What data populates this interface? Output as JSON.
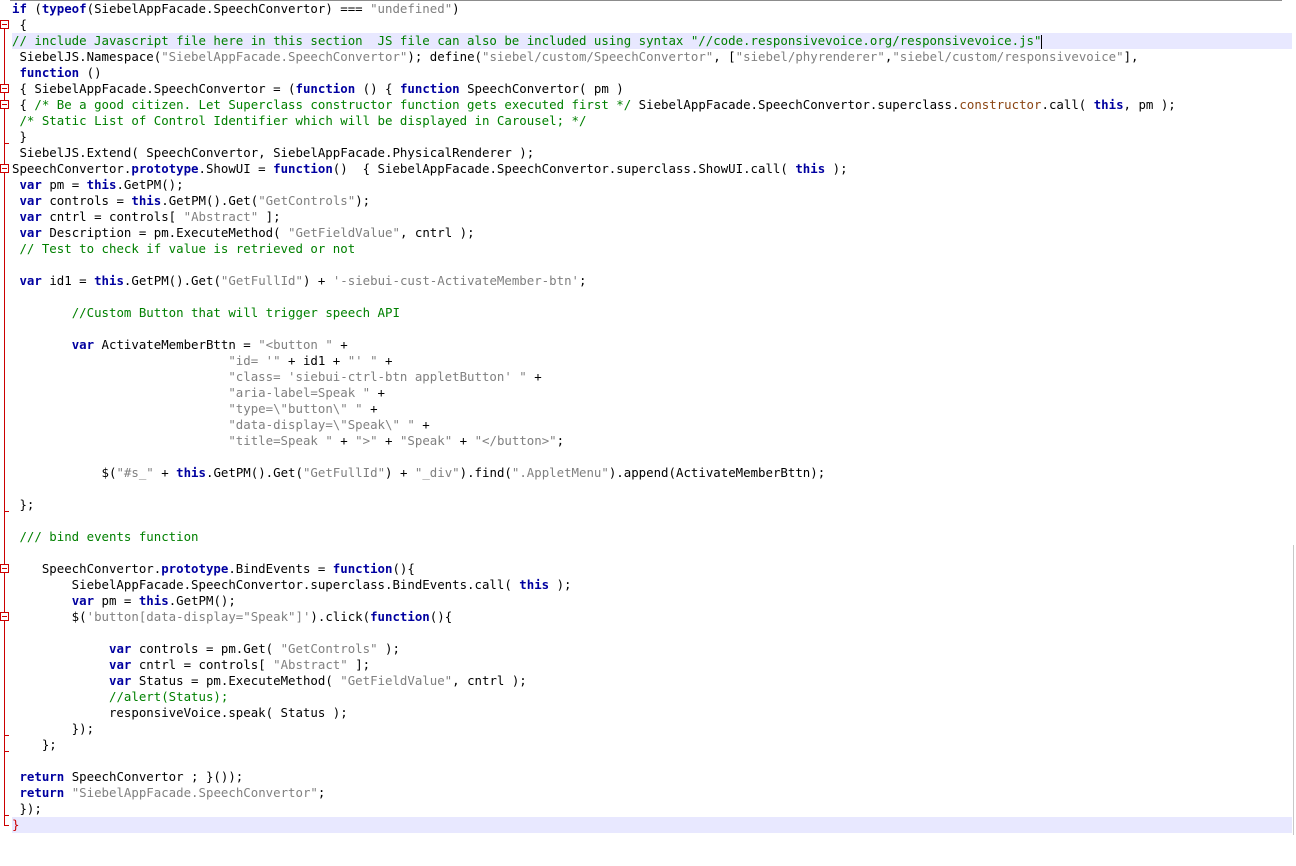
{
  "editor": {
    "language": "javascript",
    "colors": {
      "keyword": "#0000a0",
      "string": "#808080",
      "comment": "#008000",
      "brace": "#cc0000",
      "method_highlight": "#8b4513",
      "current_line_bg": "#e8e8ff",
      "fold_marker": "#cc0000"
    },
    "lines": [
      [
        [
          "kw",
          "if"
        ],
        [
          "t",
          " ("
        ],
        [
          "kw",
          "typeof"
        ],
        [
          "t",
          "(SiebelAppFacade.SpeechConvertor) === "
        ],
        [
          "str",
          "\"undefined\""
        ],
        [
          "t",
          ")"
        ]
      ],
      [
        [
          "t",
          " {"
        ]
      ],
      [
        [
          "cm",
          "// include Javascript file here in this section  JS file can also be included using syntax \"//code.responsivevoice.org/responsivevoice.js\""
        ]
      ],
      [
        [
          "t",
          " SiebelJS.Namespace("
        ],
        [
          "str",
          "\"SiebelAppFacade.SpeechConvertor\""
        ],
        [
          "t",
          "); define("
        ],
        [
          "str",
          "\"siebel/custom/SpeechConvertor\""
        ],
        [
          "t",
          ", ["
        ],
        [
          "str",
          "\"siebel/phyrenderer\""
        ],
        [
          "t",
          ","
        ],
        [
          "str",
          "\"siebel/custom/responsivevoice\""
        ],
        [
          "t",
          "],"
        ]
      ],
      [
        [
          "t",
          " "
        ],
        [
          "kw",
          "function"
        ],
        [
          "t",
          " ()"
        ]
      ],
      [
        [
          "t",
          " { SiebelAppFacade.SpeechConvertor = ("
        ],
        [
          "kw",
          "function"
        ],
        [
          "t",
          " () { "
        ],
        [
          "kw",
          "function"
        ],
        [
          "t",
          " SpeechConvertor( pm )"
        ]
      ],
      [
        [
          "t",
          " { "
        ],
        [
          "cm",
          "/* Be a good citizen. Let Superclass constructor function gets executed first */"
        ],
        [
          "t",
          " SiebelAppFacade.SpeechConvertor.superclass."
        ],
        [
          "fn",
          "constructor"
        ],
        [
          "t",
          ".call( "
        ],
        [
          "kw",
          "this"
        ],
        [
          "t",
          ", pm );"
        ]
      ],
      [
        [
          "t",
          " "
        ],
        [
          "cm",
          "/* Static List of Control Identifier which will be displayed in Carousel; */"
        ]
      ],
      [
        [
          "t",
          " }"
        ]
      ],
      [
        [
          "t",
          " SiebelJS.Extend( SpeechConvertor, SiebelAppFacade.PhysicalRenderer );"
        ]
      ],
      [
        [
          "t",
          "SpeechConvertor."
        ],
        [
          "kw",
          "prototype"
        ],
        [
          "t",
          ".ShowUI = "
        ],
        [
          "kw",
          "function"
        ],
        [
          "t",
          "()  { SiebelAppFacade.SpeechConvertor.superclass.ShowUI.call( "
        ],
        [
          "kw",
          "this"
        ],
        [
          "t",
          " );"
        ]
      ],
      [
        [
          "t",
          " "
        ],
        [
          "kw",
          "var"
        ],
        [
          "t",
          " pm = "
        ],
        [
          "kw",
          "this"
        ],
        [
          "t",
          ".GetPM();"
        ]
      ],
      [
        [
          "t",
          " "
        ],
        [
          "kw",
          "var"
        ],
        [
          "t",
          " controls = "
        ],
        [
          "kw",
          "this"
        ],
        [
          "t",
          ".GetPM().Get("
        ],
        [
          "str",
          "\"GetControls\""
        ],
        [
          "t",
          ");"
        ]
      ],
      [
        [
          "t",
          " "
        ],
        [
          "kw",
          "var"
        ],
        [
          "t",
          " cntrl = controls[ "
        ],
        [
          "str",
          "\"Abstract\""
        ],
        [
          "t",
          " ];"
        ]
      ],
      [
        [
          "t",
          " "
        ],
        [
          "kw",
          "var"
        ],
        [
          "t",
          " Description = pm.ExecuteMethod( "
        ],
        [
          "str",
          "\"GetFieldValue\""
        ],
        [
          "t",
          ", cntrl );"
        ]
      ],
      [
        [
          "t",
          " "
        ],
        [
          "cm",
          "// Test to check if value is retrieved or not"
        ]
      ],
      [
        [
          "t",
          ""
        ]
      ],
      [
        [
          "t",
          " "
        ],
        [
          "kw",
          "var"
        ],
        [
          "t",
          " id1 = "
        ],
        [
          "kw",
          "this"
        ],
        [
          "t",
          ".GetPM().Get("
        ],
        [
          "str",
          "\"GetFullId\""
        ],
        [
          "t",
          ") + "
        ],
        [
          "str",
          "'-siebui-cust-ActivateMember-btn'"
        ],
        [
          "t",
          ";"
        ]
      ],
      [
        [
          "t",
          ""
        ]
      ],
      [
        [
          "t",
          "        "
        ],
        [
          "cm",
          "//Custom Button that will trigger speech API"
        ]
      ],
      [
        [
          "t",
          ""
        ]
      ],
      [
        [
          "t",
          "        "
        ],
        [
          "kw",
          "var"
        ],
        [
          "t",
          " ActivateMemberBttn = "
        ],
        [
          "str",
          "\"<button \""
        ],
        [
          "t",
          " +"
        ]
      ],
      [
        [
          "t",
          "                             "
        ],
        [
          "str",
          "\"id= '\""
        ],
        [
          "t",
          " + id1 + "
        ],
        [
          "str",
          "\"' \""
        ],
        [
          "t",
          " +"
        ]
      ],
      [
        [
          "t",
          "                             "
        ],
        [
          "str",
          "\"class= 'siebui-ctrl-btn appletButton' \""
        ],
        [
          "t",
          " +"
        ]
      ],
      [
        [
          "t",
          "                             "
        ],
        [
          "str",
          "\"aria-label=Speak \""
        ],
        [
          "t",
          " +"
        ]
      ],
      [
        [
          "t",
          "                             "
        ],
        [
          "str",
          "\"type=\\\"button\\\" \""
        ],
        [
          "t",
          " +"
        ]
      ],
      [
        [
          "t",
          "                             "
        ],
        [
          "str",
          "\"data-display=\\\"Speak\\\" \""
        ],
        [
          "t",
          " +"
        ]
      ],
      [
        [
          "t",
          "                             "
        ],
        [
          "str",
          "\"title=Speak \""
        ],
        [
          "t",
          " + "
        ],
        [
          "str",
          "\">\""
        ],
        [
          "t",
          " + "
        ],
        [
          "str",
          "\"Speak\""
        ],
        [
          "t",
          " + "
        ],
        [
          "str",
          "\"</button>\""
        ],
        [
          "t",
          ";"
        ]
      ],
      [
        [
          "t",
          ""
        ]
      ],
      [
        [
          "t",
          "            $("
        ],
        [
          "str",
          "\"#s_\""
        ],
        [
          "t",
          " + "
        ],
        [
          "kw",
          "this"
        ],
        [
          "t",
          ".GetPM().Get("
        ],
        [
          "str",
          "\"GetFullId\""
        ],
        [
          "t",
          ") + "
        ],
        [
          "str",
          "\"_div\""
        ],
        [
          "t",
          ").find("
        ],
        [
          "str",
          "\".AppletMenu\""
        ],
        [
          "t",
          ").append(ActivateMemberBttn);"
        ]
      ],
      [
        [
          "t",
          ""
        ]
      ],
      [
        [
          "t",
          " };"
        ]
      ],
      [
        [
          "t",
          ""
        ]
      ],
      [
        [
          "t",
          " "
        ],
        [
          "cm",
          "/// bind events function"
        ]
      ],
      [
        [
          "t",
          ""
        ]
      ],
      [
        [
          "t",
          "    SpeechConvertor."
        ],
        [
          "kw",
          "prototype"
        ],
        [
          "t",
          ".BindEvents = "
        ],
        [
          "kw",
          "function"
        ],
        [
          "t",
          "(){"
        ]
      ],
      [
        [
          "t",
          "        SiebelAppFacade.SpeechConvertor.superclass.BindEvents.call( "
        ],
        [
          "kw",
          "this"
        ],
        [
          "t",
          " );"
        ]
      ],
      [
        [
          "t",
          "        "
        ],
        [
          "kw",
          "var"
        ],
        [
          "t",
          " pm = "
        ],
        [
          "kw",
          "this"
        ],
        [
          "t",
          ".GetPM();"
        ]
      ],
      [
        [
          "t",
          "        $("
        ],
        [
          "str",
          "'button[data-display=\"Speak\"]'"
        ],
        [
          "t",
          ").click("
        ],
        [
          "kw",
          "function"
        ],
        [
          "t",
          "(){"
        ]
      ],
      [
        [
          "t",
          ""
        ]
      ],
      [
        [
          "t",
          "             "
        ],
        [
          "kw",
          "var"
        ],
        [
          "t",
          " controls = pm.Get( "
        ],
        [
          "str",
          "\"GetControls\""
        ],
        [
          "t",
          " );"
        ]
      ],
      [
        [
          "t",
          "             "
        ],
        [
          "kw",
          "var"
        ],
        [
          "t",
          " cntrl = controls[ "
        ],
        [
          "str",
          "\"Abstract\""
        ],
        [
          "t",
          " ];"
        ]
      ],
      [
        [
          "t",
          "             "
        ],
        [
          "kw",
          "var"
        ],
        [
          "t",
          " Status = pm.ExecuteMethod( "
        ],
        [
          "str",
          "\"GetFieldValue\""
        ],
        [
          "t",
          ", cntrl );"
        ]
      ],
      [
        [
          "t",
          "             "
        ],
        [
          "cm",
          "//alert(Status);"
        ]
      ],
      [
        [
          "t",
          "             responsiveVoice.speak( Status );"
        ]
      ],
      [
        [
          "t",
          "        });"
        ]
      ],
      [
        [
          "t",
          "    };"
        ]
      ],
      [
        [
          "t",
          ""
        ]
      ],
      [
        [
          "t",
          " "
        ],
        [
          "kw",
          "return"
        ],
        [
          "t",
          " SpeechConvertor ; }());"
        ]
      ],
      [
        [
          "t",
          " "
        ],
        [
          "kw",
          "return"
        ],
        [
          "t",
          " "
        ],
        [
          "str",
          "\"SiebelAppFacade.SpeechConvertor\""
        ],
        [
          "t",
          ";"
        ]
      ],
      [
        [
          "t",
          " });"
        ]
      ],
      [
        [
          "br",
          "}"
        ]
      ]
    ],
    "current_line_indexes": [
      2,
      51
    ],
    "caret_after_line": 2
  }
}
